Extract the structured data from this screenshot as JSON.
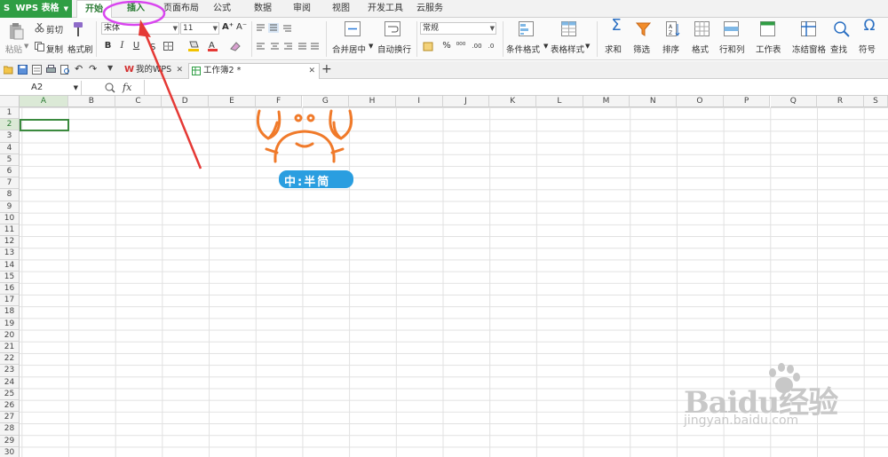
{
  "app": {
    "name": "WPS 表格",
    "logo_letter": "S"
  },
  "menu_tabs": [
    {
      "label": "开始",
      "active": true
    },
    {
      "label": "插入"
    },
    {
      "label": "页面布局"
    },
    {
      "label": "公式"
    },
    {
      "label": "数据"
    },
    {
      "label": "审阅"
    },
    {
      "label": "视图"
    },
    {
      "label": "开发工具"
    },
    {
      "label": "云服务"
    }
  ],
  "ribbon": {
    "paste": "粘贴",
    "cut": "剪切",
    "copy": "复制",
    "format_painter": "格式刷",
    "font_name": "宋体",
    "font_size": "11",
    "bold": "B",
    "italic": "I",
    "underline": "U",
    "number_format": "常规",
    "percent": "%",
    "merge_center": "合并居中",
    "wrap_text": "自动换行",
    "conditional_format": "条件格式",
    "table_style": "表格样式",
    "sum": "求和",
    "filter": "筛选",
    "sort": "排序",
    "format": "格式",
    "row_col": "行和列",
    "worksheet": "工作表",
    "freeze": "冻结窗格",
    "find": "查找",
    "symbol": "符号"
  },
  "doc_tabs": [
    {
      "label": "我的WPS"
    },
    {
      "label": "工作簿2 *",
      "active": true
    }
  ],
  "formula_bar": {
    "name_box": "A2",
    "fx": "fx"
  },
  "columns": [
    "A",
    "B",
    "C",
    "D",
    "E",
    "F",
    "G",
    "H",
    "I",
    "J",
    "K",
    "L",
    "M",
    "N",
    "O",
    "P",
    "Q",
    "R",
    "S"
  ],
  "rows": [
    "1",
    "2",
    "3",
    "4",
    "5",
    "6",
    "7",
    "8",
    "9",
    "10",
    "11",
    "12",
    "13",
    "14",
    "15",
    "16",
    "17",
    "18",
    "19",
    "20",
    "21",
    "22",
    "23",
    "24",
    "25",
    "26",
    "27",
    "28",
    "29",
    "30"
  ],
  "selected": {
    "column": "A",
    "row": "2"
  },
  "sticker": {
    "text": "中:半简"
  },
  "watermark": {
    "brand": "Baidu经验",
    "url": "jingyan.baidu.com"
  },
  "colors": {
    "accent_green": "#2f9e44",
    "highlight_circle": "#d946ef",
    "arrow": "#e53935",
    "crab": "#f07a2a",
    "sticker_blue": "#2a9ee0"
  }
}
